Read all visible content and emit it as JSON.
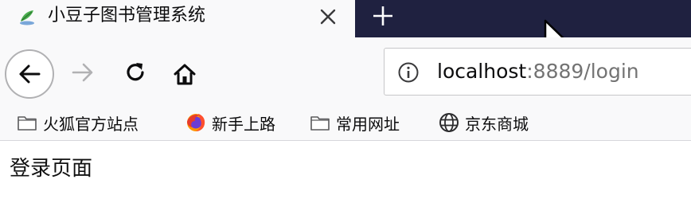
{
  "tab": {
    "title": "小豆子图书管理系统",
    "favicon": "bean-leaf-logo-icon",
    "close_icon": "close-icon",
    "new_tab_icon": "plus-icon"
  },
  "nav": {
    "back_icon": "arrow-left-icon",
    "forward_icon": "arrow-right-icon",
    "reload_icon": "reload-icon",
    "home_icon": "home-icon"
  },
  "url": {
    "info_icon": "info-icon",
    "host": "localhost",
    "path": ":8889/login"
  },
  "bookmarks": [
    {
      "label": "火狐官方站点",
      "icon": "folder-icon"
    },
    {
      "label": "新手上路",
      "icon": "firefox-icon"
    },
    {
      "label": "常用网址",
      "icon": "folder-icon"
    },
    {
      "label": "京东商城",
      "icon": "globe-icon"
    }
  ],
  "page": {
    "heading": "登录页面"
  },
  "colors": {
    "tabstrip_bg": "#1f2140",
    "toolbar_bg": "#f9f9fa",
    "url_path": "#737373"
  }
}
